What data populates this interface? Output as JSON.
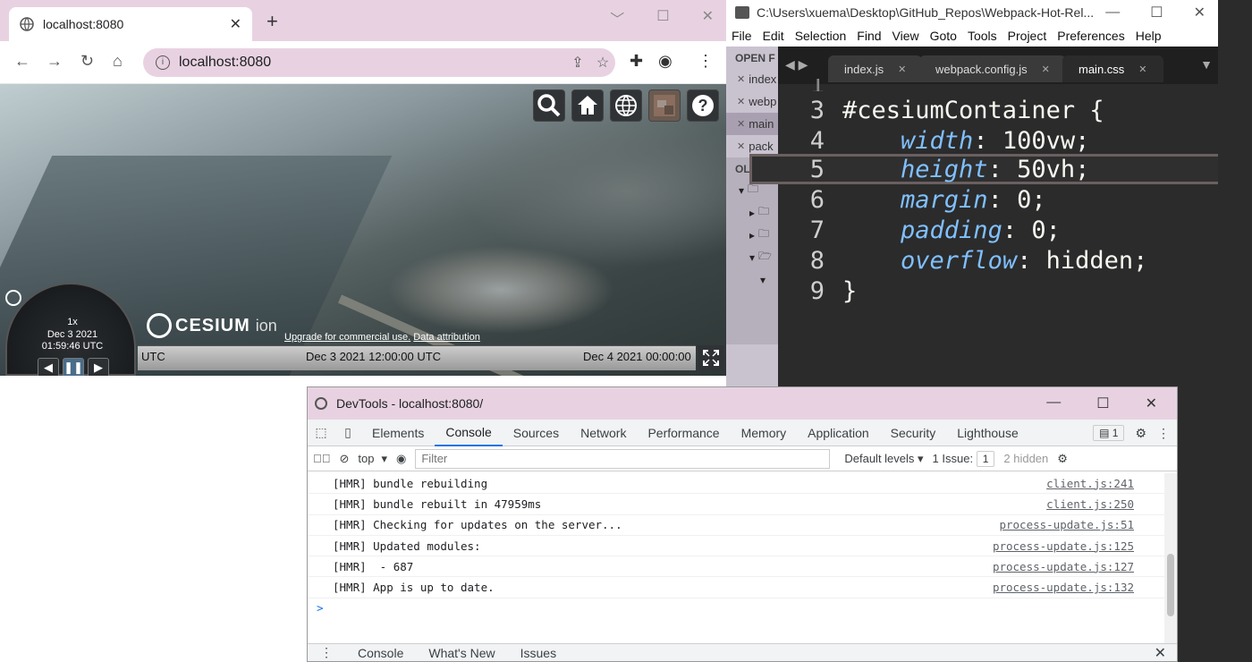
{
  "chrome": {
    "tab_title": "localhost:8080",
    "url": "localhost:8080",
    "window_controls": [
      "minimize",
      "maximize",
      "close"
    ]
  },
  "cesium": {
    "nav_buttons": [
      "search-icon",
      "home-icon",
      "globe-icon",
      "imagery-picker-icon",
      "help-icon"
    ],
    "speed": "1x",
    "date": "Dec 3 2021",
    "time": "01:59:46 UTC",
    "logo_brand": "CESIUM",
    "logo_ion": "ion",
    "credit_upgrade": "Upgrade for commercial use.",
    "credit_attribution": "Data attribution",
    "timeline_utc": "UTC",
    "timeline_mid": "Dec 3 2021 12:00:00 UTC",
    "timeline_right": "Dec 4 2021 00:00:00 UTC"
  },
  "sublime": {
    "title_path": "C:\\Users\\xuema\\Desktop\\GitHub_Repos\\Webpack-Hot-Rel...",
    "menu": [
      "File",
      "Edit",
      "Selection",
      "Find",
      "View",
      "Goto",
      "Tools",
      "Project",
      "Preferences",
      "Help"
    ],
    "sidebar_header": "OPEN F",
    "open_files": [
      "index",
      "webp",
      "main",
      "pack"
    ],
    "folders_header": "OLDER",
    "tabs": [
      "index.js",
      "webpack.config.js",
      "main.css"
    ],
    "code_lines": [
      {
        "ln": "3",
        "selector": "#cesiumContainer {"
      },
      {
        "ln": "4",
        "prop": "width",
        "val": ": 100vw;"
      },
      {
        "ln": "5",
        "prop": "height",
        "val": ": 50vh;"
      },
      {
        "ln": "6",
        "prop": "margin",
        "val": ": 0;"
      },
      {
        "ln": "7",
        "prop": "padding",
        "val": ": 0;"
      },
      {
        "ln": "8",
        "prop": "overflow",
        "val": ": hidden;"
      },
      {
        "ln": "9",
        "selector": "}"
      }
    ]
  },
  "devtools": {
    "title": "DevTools - localhost:8080/",
    "tabs": [
      "Elements",
      "Console",
      "Sources",
      "Network",
      "Performance",
      "Memory",
      "Application",
      "Security",
      "Lighthouse"
    ],
    "active_tab": "Console",
    "issues_badge": "1",
    "context": "top",
    "filter_placeholder": "Filter",
    "levels": "Default levels",
    "issue_count": "1 Issue:",
    "issue_badge_count": "1",
    "hidden_count": "2 hidden",
    "messages": [
      {
        "text": "[HMR] bundle rebuilding",
        "src": "client.js:241"
      },
      {
        "text": "[HMR] bundle rebuilt in 47959ms",
        "src": "client.js:250"
      },
      {
        "text": "[HMR] Checking for updates on the server...",
        "src": "process-update.js:51"
      },
      {
        "text": "[HMR] Updated modules:",
        "src": "process-update.js:125"
      },
      {
        "text": "[HMR]  - 687",
        "src": "process-update.js:127"
      },
      {
        "text": "[HMR] App is up to date.",
        "src": "process-update.js:132"
      }
    ],
    "prompt": ">",
    "drawer_tabs": [
      "Console",
      "What's New",
      "Issues"
    ]
  }
}
